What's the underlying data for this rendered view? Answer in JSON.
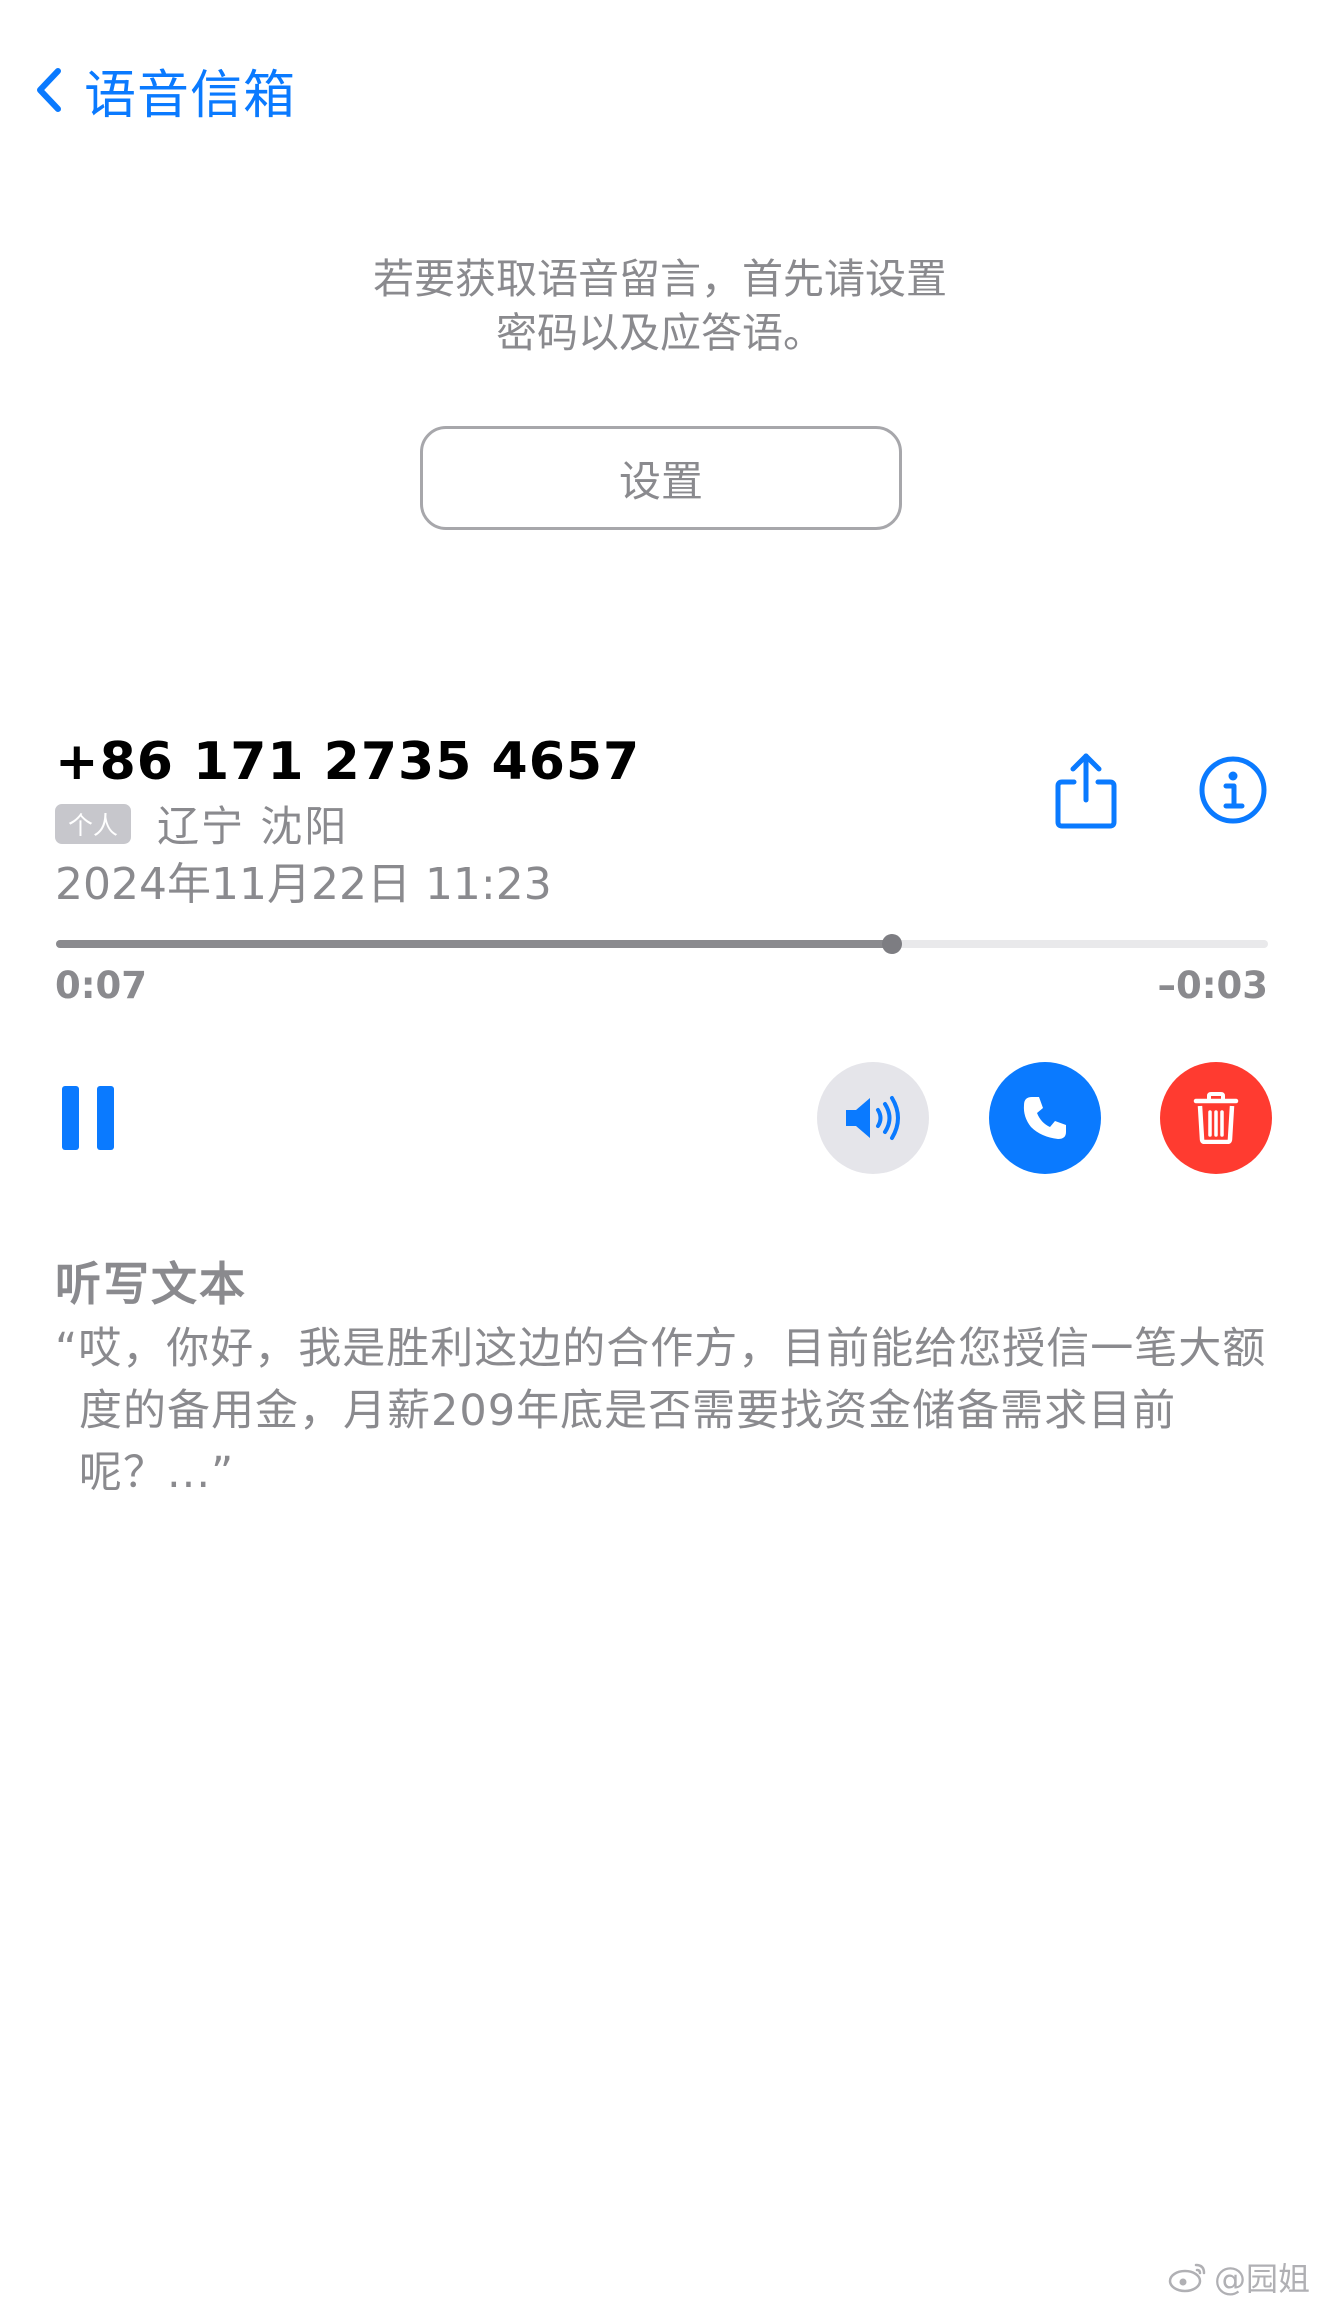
{
  "nav": {
    "back_label": "语音信箱"
  },
  "setup": {
    "message": "若要获取语音留言，首先请设置\n密码以及应答语。",
    "button_label": "设置"
  },
  "voicemail": {
    "number": "+86 171 2735 4657",
    "tag": "个人",
    "location": "辽宁 沈阳",
    "datetime": "2024年11月22日 11:23",
    "elapsed": "0:07",
    "remaining": "–0:03",
    "progress_fraction": 0.69
  },
  "transcript": {
    "title": "听写文本",
    "text": "“哎，你好，我是胜利这边的合作方，目前能给您授信一笔大额度的备用金，月薪209年底是否需要找资金储备需求目前呢？...”"
  },
  "icons": {
    "back": "chevron-left-icon",
    "share": "share-icon",
    "info": "info-icon",
    "pause": "pause-icon",
    "speaker": "speaker-icon",
    "call": "phone-icon",
    "delete": "trash-icon"
  },
  "colors": {
    "accent": "#0a7aff",
    "delete": "#ff3b30",
    "secondary_text": "#8a8a8e"
  },
  "watermark": "@园姐"
}
